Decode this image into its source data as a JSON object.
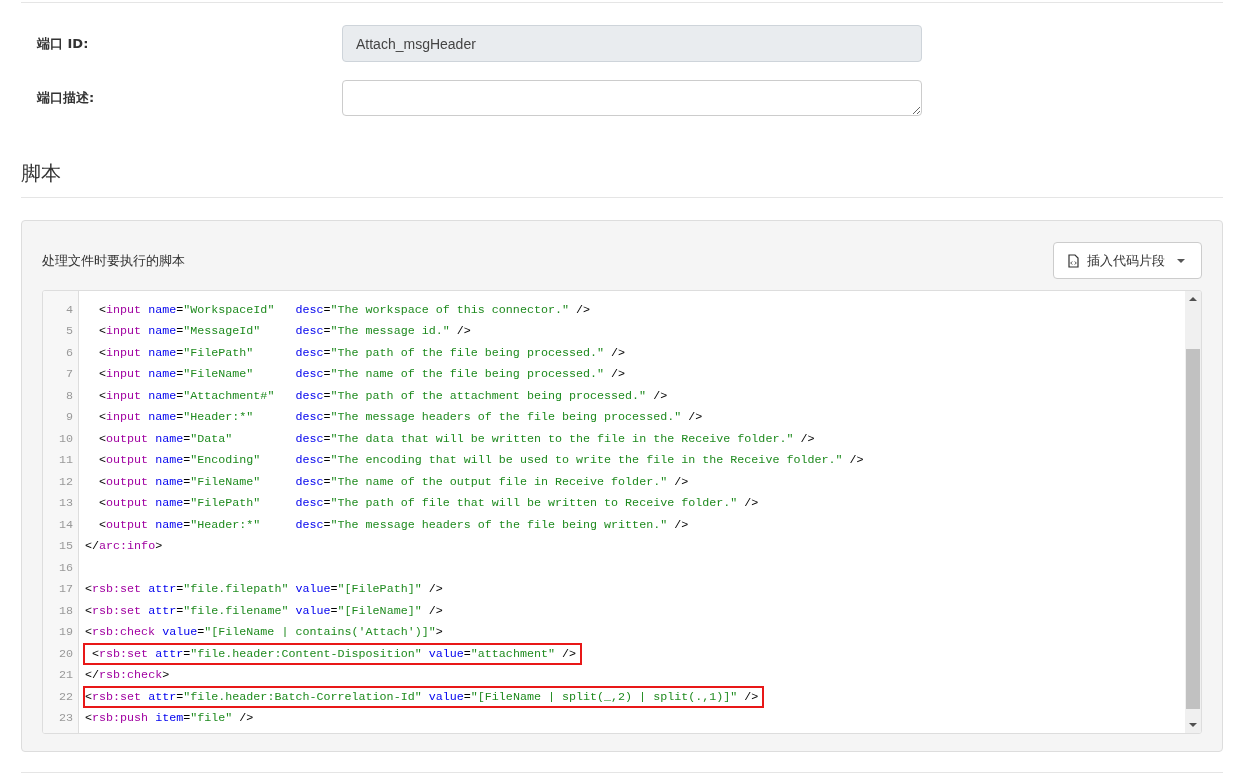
{
  "fields": [
    {
      "label": "端口 ID:",
      "kind": "text",
      "value": "Attach_msgHeader",
      "disabled": true
    },
    {
      "label": "端口描述:",
      "kind": "textarea",
      "disabled": false
    }
  ],
  "section_title": "脚本",
  "script_panel": {
    "caption": "处理文件时要执行的脚本",
    "snippet_button": {
      "label": "插入代码片段"
    },
    "code_lines": [
      {
        "number": "4",
        "highlighted": false,
        "tokens": [
          {
            "kind": "punct",
            "text": "  <"
          },
          {
            "kind": "tag",
            "text": "input"
          },
          {
            "kind": "attr",
            "text": " name"
          },
          {
            "kind": "punct",
            "text": "="
          },
          {
            "kind": "string",
            "text": "\"WorkspaceId\"   "
          },
          {
            "kind": "attr",
            "text": "desc"
          },
          {
            "kind": "punct",
            "text": "="
          },
          {
            "kind": "string",
            "text": "\"The workspace of this connector.\""
          },
          {
            "kind": "punct",
            "text": " />"
          }
        ]
      },
      {
        "number": "5",
        "highlighted": false,
        "tokens": [
          {
            "kind": "punct",
            "text": "  <"
          },
          {
            "kind": "tag",
            "text": "input"
          },
          {
            "kind": "attr",
            "text": " name"
          },
          {
            "kind": "punct",
            "text": "="
          },
          {
            "kind": "string",
            "text": "\"MessageId\"     "
          },
          {
            "kind": "attr",
            "text": "desc"
          },
          {
            "kind": "punct",
            "text": "="
          },
          {
            "kind": "string",
            "text": "\"The message id.\""
          },
          {
            "kind": "punct",
            "text": " />"
          }
        ]
      },
      {
        "number": "6",
        "highlighted": false,
        "tokens": [
          {
            "kind": "punct",
            "text": "  <"
          },
          {
            "kind": "tag",
            "text": "input"
          },
          {
            "kind": "attr",
            "text": " name"
          },
          {
            "kind": "punct",
            "text": "="
          },
          {
            "kind": "string",
            "text": "\"FilePath\"      "
          },
          {
            "kind": "attr",
            "text": "desc"
          },
          {
            "kind": "punct",
            "text": "="
          },
          {
            "kind": "string",
            "text": "\"The path of the file being processed.\""
          },
          {
            "kind": "punct",
            "text": " />"
          }
        ]
      },
      {
        "number": "7",
        "highlighted": false,
        "tokens": [
          {
            "kind": "punct",
            "text": "  <"
          },
          {
            "kind": "tag",
            "text": "input"
          },
          {
            "kind": "attr",
            "text": " name"
          },
          {
            "kind": "punct",
            "text": "="
          },
          {
            "kind": "string",
            "text": "\"FileName\"      "
          },
          {
            "kind": "attr",
            "text": "desc"
          },
          {
            "kind": "punct",
            "text": "="
          },
          {
            "kind": "string",
            "text": "\"The name of the file being processed.\""
          },
          {
            "kind": "punct",
            "text": " />"
          }
        ]
      },
      {
        "number": "8",
        "highlighted": false,
        "tokens": [
          {
            "kind": "punct",
            "text": "  <"
          },
          {
            "kind": "tag",
            "text": "input"
          },
          {
            "kind": "attr",
            "text": " name"
          },
          {
            "kind": "punct",
            "text": "="
          },
          {
            "kind": "string",
            "text": "\"Attachment#\"   "
          },
          {
            "kind": "attr",
            "text": "desc"
          },
          {
            "kind": "punct",
            "text": "="
          },
          {
            "kind": "string",
            "text": "\"The path of the attachment being processed.\""
          },
          {
            "kind": "punct",
            "text": " />"
          }
        ]
      },
      {
        "number": "9",
        "highlighted": false,
        "tokens": [
          {
            "kind": "punct",
            "text": "  <"
          },
          {
            "kind": "tag",
            "text": "input"
          },
          {
            "kind": "attr",
            "text": " name"
          },
          {
            "kind": "punct",
            "text": "="
          },
          {
            "kind": "string",
            "text": "\"Header:*\"      "
          },
          {
            "kind": "attr",
            "text": "desc"
          },
          {
            "kind": "punct",
            "text": "="
          },
          {
            "kind": "string",
            "text": "\"The message headers of the file being processed.\""
          },
          {
            "kind": "punct",
            "text": " />"
          }
        ]
      },
      {
        "number": "10",
        "highlighted": false,
        "tokens": [
          {
            "kind": "punct",
            "text": "  <"
          },
          {
            "kind": "tag",
            "text": "output"
          },
          {
            "kind": "attr",
            "text": " name"
          },
          {
            "kind": "punct",
            "text": "="
          },
          {
            "kind": "string",
            "text": "\"Data\"         "
          },
          {
            "kind": "attr",
            "text": "desc"
          },
          {
            "kind": "punct",
            "text": "="
          },
          {
            "kind": "string",
            "text": "\"The data that will be written to the file in the Receive folder.\""
          },
          {
            "kind": "punct",
            "text": " />"
          }
        ]
      },
      {
        "number": "11",
        "highlighted": false,
        "tokens": [
          {
            "kind": "punct",
            "text": "  <"
          },
          {
            "kind": "tag",
            "text": "output"
          },
          {
            "kind": "attr",
            "text": " name"
          },
          {
            "kind": "punct",
            "text": "="
          },
          {
            "kind": "string",
            "text": "\"Encoding\"     "
          },
          {
            "kind": "attr",
            "text": "desc"
          },
          {
            "kind": "punct",
            "text": "="
          },
          {
            "kind": "string",
            "text": "\"The encoding that will be used to write the file in the Receive folder.\""
          },
          {
            "kind": "punct",
            "text": " />"
          }
        ]
      },
      {
        "number": "12",
        "highlighted": false,
        "tokens": [
          {
            "kind": "punct",
            "text": "  <"
          },
          {
            "kind": "tag",
            "text": "output"
          },
          {
            "kind": "attr",
            "text": " name"
          },
          {
            "kind": "punct",
            "text": "="
          },
          {
            "kind": "string",
            "text": "\"FileName\"     "
          },
          {
            "kind": "attr",
            "text": "desc"
          },
          {
            "kind": "punct",
            "text": "="
          },
          {
            "kind": "string",
            "text": "\"The name of the output file in Receive folder.\""
          },
          {
            "kind": "punct",
            "text": " />"
          }
        ]
      },
      {
        "number": "13",
        "highlighted": false,
        "tokens": [
          {
            "kind": "punct",
            "text": "  <"
          },
          {
            "kind": "tag",
            "text": "output"
          },
          {
            "kind": "attr",
            "text": " name"
          },
          {
            "kind": "punct",
            "text": "="
          },
          {
            "kind": "string",
            "text": "\"FilePath\"     "
          },
          {
            "kind": "attr",
            "text": "desc"
          },
          {
            "kind": "punct",
            "text": "="
          },
          {
            "kind": "string",
            "text": "\"The path of file that will be written to Receive folder.\""
          },
          {
            "kind": "punct",
            "text": " />"
          }
        ]
      },
      {
        "number": "14",
        "highlighted": false,
        "tokens": [
          {
            "kind": "punct",
            "text": "  <"
          },
          {
            "kind": "tag",
            "text": "output"
          },
          {
            "kind": "attr",
            "text": " name"
          },
          {
            "kind": "punct",
            "text": "="
          },
          {
            "kind": "string",
            "text": "\"Header:*\"     "
          },
          {
            "kind": "attr",
            "text": "desc"
          },
          {
            "kind": "punct",
            "text": "="
          },
          {
            "kind": "string",
            "text": "\"The message headers of the file being written.\""
          },
          {
            "kind": "punct",
            "text": " />"
          }
        ]
      },
      {
        "number": "15",
        "highlighted": false,
        "tokens": [
          {
            "kind": "punct",
            "text": "</"
          },
          {
            "kind": "tag",
            "text": "arc:info"
          },
          {
            "kind": "punct",
            "text": ">"
          }
        ]
      },
      {
        "number": "16",
        "highlighted": false
      },
      {
        "number": "17",
        "highlighted": false,
        "tokens": [
          {
            "kind": "punct",
            "text": "<"
          },
          {
            "kind": "tag",
            "text": "rsb:set"
          },
          {
            "kind": "attr",
            "text": " attr"
          },
          {
            "kind": "punct",
            "text": "="
          },
          {
            "kind": "string",
            "text": "\"file.filepath\" "
          },
          {
            "kind": "attr",
            "text": "value"
          },
          {
            "kind": "punct",
            "text": "="
          },
          {
            "kind": "string",
            "text": "\"[FilePath]\""
          },
          {
            "kind": "punct",
            "text": " />"
          }
        ]
      },
      {
        "number": "18",
        "highlighted": false,
        "tokens": [
          {
            "kind": "punct",
            "text": "<"
          },
          {
            "kind": "tag",
            "text": "rsb:set"
          },
          {
            "kind": "attr",
            "text": " attr"
          },
          {
            "kind": "punct",
            "text": "="
          },
          {
            "kind": "string",
            "text": "\"file.filename\" "
          },
          {
            "kind": "attr",
            "text": "value"
          },
          {
            "kind": "punct",
            "text": "="
          },
          {
            "kind": "string",
            "text": "\"[FileName]\""
          },
          {
            "kind": "punct",
            "text": " />"
          }
        ]
      },
      {
        "number": "19",
        "highlighted": false,
        "tokens": [
          {
            "kind": "punct",
            "text": "<"
          },
          {
            "kind": "tag",
            "text": "rsb:check"
          },
          {
            "kind": "attr",
            "text": " value"
          },
          {
            "kind": "punct",
            "text": "="
          },
          {
            "kind": "string",
            "text": "\"[FileName | contains('Attach')]\""
          },
          {
            "kind": "punct",
            "text": ">"
          }
        ]
      },
      {
        "number": "20",
        "highlighted": true,
        "tokens": [
          {
            "kind": "punct",
            "text": " <"
          },
          {
            "kind": "tag",
            "text": "rsb:set"
          },
          {
            "kind": "attr",
            "text": " attr"
          },
          {
            "kind": "punct",
            "text": "="
          },
          {
            "kind": "string",
            "text": "\"file.header:Content-Disposition\" "
          },
          {
            "kind": "attr",
            "text": "value"
          },
          {
            "kind": "punct",
            "text": "="
          },
          {
            "kind": "string",
            "text": "\"attachment\""
          },
          {
            "kind": "punct",
            "text": " />"
          }
        ]
      },
      {
        "number": "21",
        "highlighted": false,
        "tokens": [
          {
            "kind": "punct",
            "text": "</"
          },
          {
            "kind": "tag",
            "text": "rsb:check"
          },
          {
            "kind": "punct",
            "text": ">"
          }
        ]
      },
      {
        "number": "22",
        "highlighted": true,
        "tokens": [
          {
            "kind": "punct",
            "text": "<"
          },
          {
            "kind": "tag",
            "text": "rsb:set"
          },
          {
            "kind": "attr",
            "text": " attr"
          },
          {
            "kind": "punct",
            "text": "="
          },
          {
            "kind": "string",
            "text": "\"file.header:Batch-Correlation-Id\" "
          },
          {
            "kind": "attr",
            "text": "value"
          },
          {
            "kind": "punct",
            "text": "="
          },
          {
            "kind": "string",
            "text": "\"[FileName | split(_,2) | split(.,1)]\""
          },
          {
            "kind": "punct",
            "text": " />"
          }
        ]
      },
      {
        "number": "23",
        "highlighted": false,
        "tokens": [
          {
            "kind": "punct",
            "text": "<"
          },
          {
            "kind": "tag",
            "text": "rsb:push"
          },
          {
            "kind": "attr",
            "text": " item"
          },
          {
            "kind": "punct",
            "text": "="
          },
          {
            "kind": "string",
            "text": "\"file\""
          },
          {
            "kind": "punct",
            "text": " />"
          }
        ]
      }
    ]
  }
}
